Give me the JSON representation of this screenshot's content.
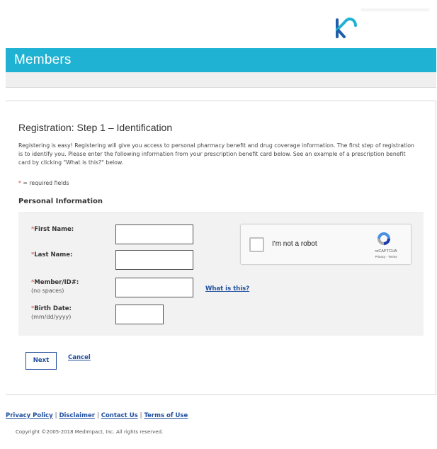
{
  "brand": {
    "logo_icon": "brand-logo-icon",
    "accent_color": "#1fb2d3"
  },
  "header": {
    "title": "Members"
  },
  "registration": {
    "title": "Registration: Step 1 – Identification",
    "intro": "Registering is easy! Registering will give you access to personal pharmacy benefit and drug coverage information. The first step of registration is to identify you. Please enter the following information from your prescription benefit card below. See an example of a prescription benefit card by clicking \"What is this?\" below.",
    "required_star": "*",
    "required_note": " = required fields",
    "section_title": "Personal Information"
  },
  "form": {
    "first_name": {
      "label": "First Name:",
      "value": ""
    },
    "last_name": {
      "label": "Last Name:",
      "value": ""
    },
    "member_id": {
      "label": "Member/ID#:",
      "hint": "(no spaces)",
      "value": ""
    },
    "birth_date": {
      "label": "Birth Date:",
      "hint": "(mm/dd/yyyy)",
      "value": ""
    },
    "what_is_this": "What is this?",
    "star": "*"
  },
  "captcha": {
    "label": "I'm not a robot",
    "brand": "reCAPTCHA",
    "links": "Privacy - Terms",
    "icon": "recaptcha-logo-icon"
  },
  "actions": {
    "next": "Next",
    "cancel": "Cancel"
  },
  "footer": {
    "links": [
      "Privacy Policy",
      "Disclaimer",
      "Contact Us",
      "Terms of Use"
    ],
    "separator": "|",
    "copyright": "Copyright ©2005-2018 MedImpact, Inc. All rights reserved."
  }
}
